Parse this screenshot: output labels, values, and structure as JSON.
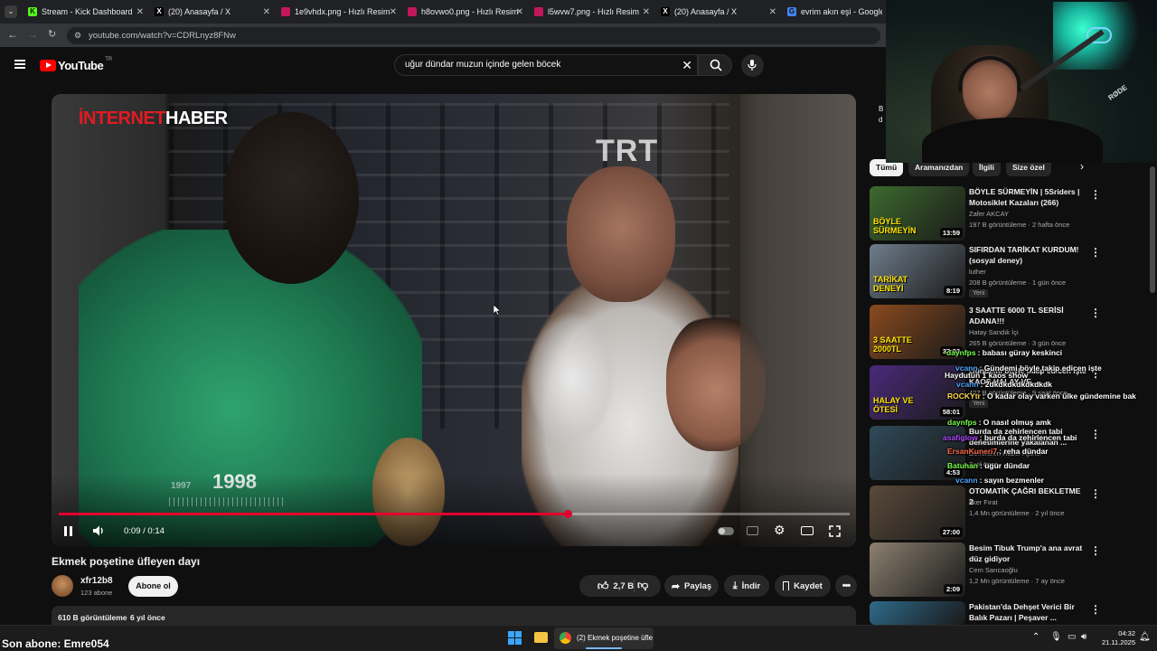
{
  "browser": {
    "tabs": [
      {
        "label": "Stream - Kick Dashboard",
        "favicon": "kick-icon",
        "color": "#53fc18"
      },
      {
        "label": "(20) Anasayfa / X",
        "favicon": "x-icon",
        "color": "#ffffff"
      },
      {
        "label": "1e9vhdx.png - Hızlı Resim",
        "favicon": "image-icon",
        "color": "#c2185b"
      },
      {
        "label": "h8ovwo0.png - Hızlı Resim",
        "favicon": "image-icon",
        "color": "#c2185b"
      },
      {
        "label": "l5wvw7.png - Hızlı Resim",
        "favicon": "image-icon",
        "color": "#c2185b"
      },
      {
        "label": "(20) Anasayfa / X",
        "favicon": "x-icon",
        "color": "#ffffff"
      },
      {
        "label": "evrim akın eşi - Google'da A",
        "favicon": "google-icon",
        "color": "#4285f4"
      }
    ],
    "url": "youtube.com/watch?v=CDRLnyz8FNw"
  },
  "youtube": {
    "logo_text": "YouTube",
    "region": "TR",
    "search_query": "uğur dündar muzun içinde gelen böcek"
  },
  "player": {
    "overlay_brand_a": "İNTERNET",
    "overlay_brand_b": "HABER",
    "watermark": "TRT",
    "year_small": "1997",
    "year_big": "1998",
    "time_current": "0:09",
    "time_total": "0:14",
    "progress": 0.643
  },
  "video": {
    "title": "Ekmek poşetine üfleyen dayı",
    "channel": "xfr12b8",
    "subscribers": "123 abone",
    "subscribe_label": "Abone ol",
    "likes": "2,7 B",
    "share_label": "Paylaş",
    "download_label": "İndir",
    "save_label": "Kaydet",
    "views": "610 B görüntüleme",
    "age": "6 yıl önce"
  },
  "sidebar": {
    "chips": [
      "Tümü",
      "Aramanızdan",
      "İlgili",
      "Size özel"
    ],
    "partial_text_1": "B",
    "partial_text_2": "d",
    "recommended": [
      {
        "title": "BÖYLE SÜRMEYİN | 5Sriders | Motosiklet Kazaları (266)",
        "channel": "Zafer AKCAY",
        "meta": "197 B görüntüleme · 2 hafta önce",
        "duration": "13:59",
        "new": "",
        "thumb_text": "BÖYLE SÜRMEYİN",
        "thumb_color": "#3d6a2e"
      },
      {
        "title": "SIFIRDAN TARİKAT KURDUM! (sosyal deney)",
        "channel": "luther",
        "meta": "208 B görüntüleme · 1 gün önce",
        "duration": "8:19",
        "new": "Yeni",
        "thumb_text": "TARİKAT DENEYİ",
        "thumb_color": "#6f7d8c"
      },
      {
        "title": "3 SAATTE 6000 TL SERİSİ ADANA!!!",
        "channel": "Hatay Sandık İçi",
        "meta": "265 B görüntüleme · 3 gün önce",
        "duration": "37:02",
        "new": "",
        "thumb_text": "3 SAATTE 2000TL",
        "thumb_color": "#8a4a1e"
      },
      {
        "title": "Gündemi böyle takip edicen işte KAOS HALAY VE ...",
        "channel": "",
        "meta": "427 B görüntüleme · 9 saat önce",
        "duration": "58:01",
        "new": "Yeni",
        "thumb_text": "HALAY VE ÖTESİ",
        "thumb_color": "#4a2a7a"
      },
      {
        "title": "Burda da zehirlencen tabi denetimlerine yakalanan ...",
        "channel": "Demirören Haber Ajansı",
        "meta": "2 yıl önce",
        "duration": "4:53",
        "new": "",
        "thumb_text": "",
        "thumb_color": "#2f4a5a"
      },
      {
        "title": "OTOMATİK ÇAĞRI BEKLETME 2",
        "channel": "İlker Fırat",
        "meta": "1,4 Mn görüntüleme · 2 yıl önce",
        "duration": "27:00",
        "new": "",
        "thumb_text": "",
        "thumb_color": "#5a4a3a"
      },
      {
        "title": "Besim Tibuk Trump'a ana avrat düz gidiyor",
        "channel": "Cem Sarıcaoğlu",
        "meta": "1,2 Mn görüntüleme · 7 ay önce",
        "duration": "2:09",
        "new": "",
        "thumb_text": "",
        "thumb_color": "#8c8070"
      },
      {
        "title": "Pakistan'da Dehşet Verici Bir Balık Pazarı | Peşaver ...",
        "channel": "",
        "meta": "",
        "duration": "",
        "new": "",
        "thumb_text": "",
        "thumb_color": "#2e6a8a"
      }
    ]
  },
  "chat": [
    {
      "user": "daynfps",
      "text": ": babası güray keskinci",
      "color": "#7cff4d"
    },
    {
      "user": "vcann",
      "text": ": Gündemi böyle takip edicen işte",
      "color": "#4da6ff"
    },
    {
      "user": "Haydutun 1 kaos show",
      "text": "",
      "color": "#ffffff"
    },
    {
      "user": "vcann",
      "text": ": 2dkdkdkdkdkdkdk",
      "color": "#4da6ff"
    },
    {
      "user": "ROCKYtr",
      "text": ": O kadar olay varken ülke gündemine bak",
      "color": "#ffd84d"
    },
    {
      "user": "daynfps",
      "text": ": O nasıl olmuş amk",
      "color": "#7cff4d"
    },
    {
      "user": "asafiglow",
      "text": ": burda da zehirlencen tabi",
      "color": "#b04dff"
    },
    {
      "user": "ErsanKuneri7",
      "text": ": reha dündar",
      "color": "#ff6a4d"
    },
    {
      "user": "Batuhan",
      "text": ": ugur dündar",
      "color": "#7cff4d"
    },
    {
      "user": "vcann",
      "text": ": sayın bezmenler",
      "color": "#4da6ff"
    }
  ],
  "stream_overlay": {
    "last_sub": "Son abone: Emre054"
  },
  "taskbar": {
    "active_window": "(2) Ekmek poşetine üfle",
    "time": "04:32",
    "date": "21.11.2025"
  },
  "webcam": {
    "mic_brand": "RØDE"
  }
}
